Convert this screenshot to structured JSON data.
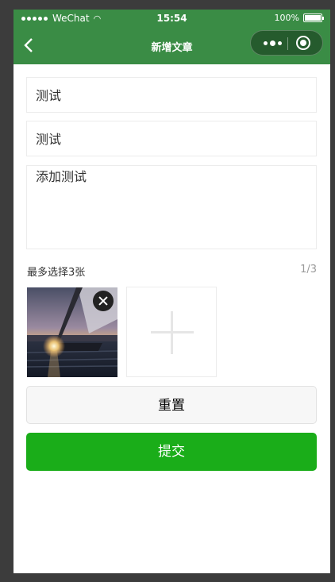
{
  "status_bar": {
    "carrier": "WeChat",
    "time": "15:54",
    "battery": "100%"
  },
  "nav": {
    "title": "新增文章"
  },
  "form": {
    "title_value": "测试",
    "subtitle_value": "测试",
    "content_value": "添加测试",
    "image_hint": "最多选择3张",
    "image_count": "1/3"
  },
  "buttons": {
    "reset": "重置",
    "submit": "提交"
  },
  "colors": {
    "nav_bg": "#3a8c45",
    "primary": "#1aad19"
  },
  "icons": [
    "back-arrow-icon",
    "more-icon",
    "close-mini-program-icon",
    "delete-image-icon",
    "plus-icon",
    "wifi-icon",
    "battery-icon"
  ]
}
